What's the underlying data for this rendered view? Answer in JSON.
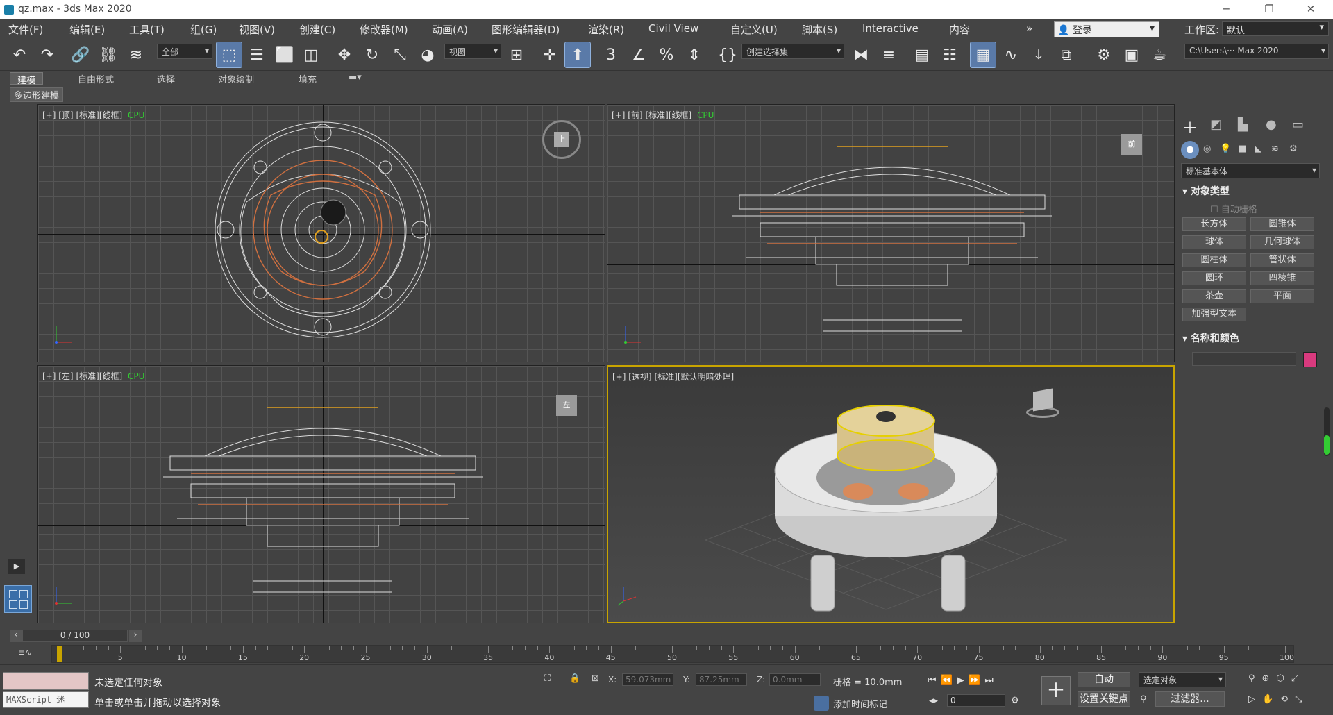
{
  "window": {
    "title": "qz.max - 3ds Max 2020",
    "minimize": "─",
    "restore": "❐",
    "close": "✕"
  },
  "menus": [
    "文件(F)",
    "编辑(E)",
    "工具(T)",
    "组(G)",
    "视图(V)",
    "创建(C)",
    "修改器(M)",
    "动画(A)",
    "图形编辑器(D)",
    "渲染(R)",
    "Civil View",
    "自定义(U)",
    "脚本(S)",
    "Interactive",
    "内容"
  ],
  "menu_more": "»",
  "login": {
    "label": "登录"
  },
  "workspace": {
    "label": "工作区:",
    "value": "默认"
  },
  "toolbar": {
    "selection_filter": "全部",
    "ref_coord": "视图",
    "named_selection": "创建选择集",
    "project_path": "C:\\Users\\··· Max 2020",
    "snap_label": "3"
  },
  "ribbon": {
    "tabs": [
      "建模",
      "自由形式",
      "选择",
      "对象绘制",
      "填充"
    ],
    "active": "建模",
    "sub": "多边形建模"
  },
  "viewports": {
    "top": {
      "plus": "[+]",
      "name": "[顶]",
      "shading": "[标准][线框]",
      "extra": "CPU",
      "cube": "上"
    },
    "front": {
      "plus": "[+]",
      "name": "[前]",
      "shading": "[标准][线框]",
      "extra": "CPU",
      "cube": "前"
    },
    "left": {
      "plus": "[+]",
      "name": "[左]",
      "shading": "[标准][线框]",
      "extra": "CPU",
      "cube": "左"
    },
    "persp": {
      "plus": "[+]",
      "name": "[透视]",
      "shading": "[标准][默认明暗处理]"
    }
  },
  "command_panel": {
    "category": "标准基本体",
    "object_type": "对象类型",
    "autogrid": "自动栅格",
    "buttons": [
      "长方体",
      "圆锥体",
      "球体",
      "几何球体",
      "圆柱体",
      "管状体",
      "圆环",
      "四棱锥",
      "茶壶",
      "平面"
    ],
    "extra_button": "加强型文本",
    "name_color": "名称和颜色",
    "object_color": "#d93a7e"
  },
  "timeline": {
    "frame_display": "0 / 100",
    "ticks": [
      "0",
      "5",
      "10",
      "15",
      "20",
      "25",
      "30",
      "35",
      "40",
      "45",
      "50",
      "55",
      "60",
      "65",
      "70",
      "75",
      "80",
      "85",
      "90",
      "95",
      "100"
    ],
    "current_frame": 0
  },
  "status": {
    "maxscript": "MAXScript 迷",
    "line1": "未选定任何对象",
    "line2": "单击或单击并拖动以选择对象",
    "x_label": "X:",
    "x": "59.073mm",
    "y_label": "Y:",
    "y": "87.25mm",
    "z_label": "Z:",
    "z": "0.0mm",
    "grid": "栅格 = 10.0mm",
    "add_tag": "添加时间标记",
    "auto": "自动",
    "set_key": "设置关键点",
    "selected": "选定对象",
    "filters": "过滤器...",
    "frame": "0"
  }
}
